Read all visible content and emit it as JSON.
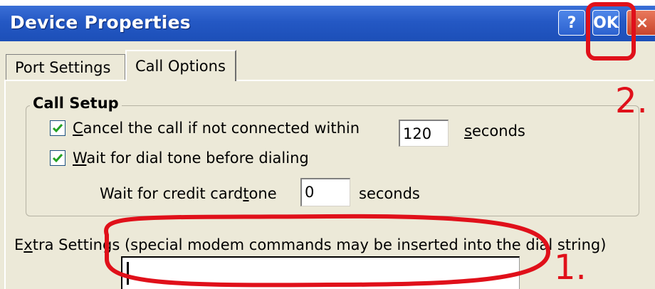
{
  "window": {
    "title": "Device Properties"
  },
  "titlebar": {
    "help_label": "?",
    "ok_label": "OK",
    "close_label": "×"
  },
  "tabs": [
    {
      "label": "Port Settings"
    },
    {
      "label": "Call Options"
    }
  ],
  "call_setup": {
    "legend": "Call Setup",
    "cancel_call": {
      "checked": true,
      "label_first": "C",
      "label_rest": "ancel the call if not connected within",
      "value": "120",
      "unit_first": "s",
      "unit_rest": "econds"
    },
    "wait_dial_tone": {
      "checked": true,
      "label_first": "W",
      "label_rest": "ait for dial tone before dialing"
    },
    "credit_card": {
      "label_pre": "Wait for credit card ",
      "label_acc": "t",
      "label_post": "one",
      "value": "0",
      "unit": "seconds"
    }
  },
  "extra_settings": {
    "label_pre": "E",
    "label_acc": "x",
    "label_post": "tra Settings (special modem commands may be inserted into the dial string)",
    "value": ""
  },
  "annotations": {
    "one": "1.",
    "two": "2.",
    "color": "#e0101a"
  },
  "colors": {
    "titlebar": "#2458c4",
    "dialog_bg": "#ece9d8",
    "checkmark": "#21a121"
  }
}
